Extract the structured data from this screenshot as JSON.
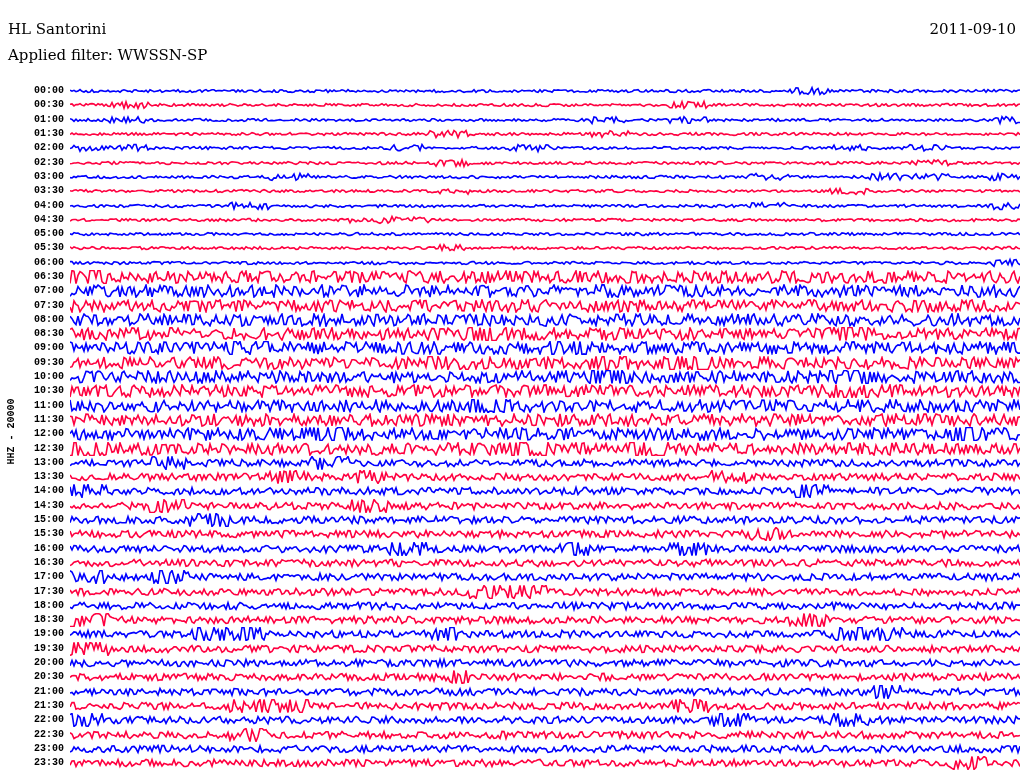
{
  "header": {
    "station": "HL Santorini",
    "date": "2011-09-10",
    "filter": "Applied filter: WWSSN-SP"
  },
  "channel_label": "HHZ - 20000",
  "rows": [
    {
      "time": "00:00",
      "color": "#0000ff"
    },
    {
      "time": "00:30",
      "color": "#ff0040"
    },
    {
      "time": "01:00",
      "color": "#0000ff"
    },
    {
      "time": "01:30",
      "color": "#ff0040"
    },
    {
      "time": "02:00",
      "color": "#0000ff"
    },
    {
      "time": "02:30",
      "color": "#ff0040"
    },
    {
      "time": "03:00",
      "color": "#0000ff"
    },
    {
      "time": "03:30",
      "color": "#ff0040"
    },
    {
      "time": "04:00",
      "color": "#0000ff"
    },
    {
      "time": "04:30",
      "color": "#ff0040"
    },
    {
      "time": "05:00",
      "color": "#0000ff"
    },
    {
      "time": "05:30",
      "color": "#ff0040"
    },
    {
      "time": "06:00",
      "color": "#0000ff"
    },
    {
      "time": "06:30",
      "color": "#ff0040"
    },
    {
      "time": "07:00",
      "color": "#0000ff"
    },
    {
      "time": "07:30",
      "color": "#ff0040"
    },
    {
      "time": "08:00",
      "color": "#0000ff"
    },
    {
      "time": "08:30",
      "color": "#ff0040"
    },
    {
      "time": "09:00",
      "color": "#0000ff"
    },
    {
      "time": "09:30",
      "color": "#ff0040"
    },
    {
      "time": "10:00",
      "color": "#0000ff"
    },
    {
      "time": "10:30",
      "color": "#ff0040"
    },
    {
      "time": "11:00",
      "color": "#0000ff"
    },
    {
      "time": "11:30",
      "color": "#ff0040"
    },
    {
      "time": "12:00",
      "color": "#0000ff"
    },
    {
      "time": "12:30",
      "color": "#ff0040"
    },
    {
      "time": "13:00",
      "color": "#0000ff"
    },
    {
      "time": "13:30",
      "color": "#ff0040"
    },
    {
      "time": "14:00",
      "color": "#0000ff"
    },
    {
      "time": "14:30",
      "color": "#ff0040"
    },
    {
      "time": "15:00",
      "color": "#0000ff"
    },
    {
      "time": "15:30",
      "color": "#ff0040"
    },
    {
      "time": "16:00",
      "color": "#0000ff"
    },
    {
      "time": "16:30",
      "color": "#ff0040"
    },
    {
      "time": "17:00",
      "color": "#0000ff"
    },
    {
      "time": "17:30",
      "color": "#ff0040"
    },
    {
      "time": "18:00",
      "color": "#0000ff"
    },
    {
      "time": "18:30",
      "color": "#ff0040"
    },
    {
      "time": "19:00",
      "color": "#0000ff"
    },
    {
      "time": "19:30",
      "color": "#ff0040"
    },
    {
      "time": "20:00",
      "color": "#0000ff"
    },
    {
      "time": "20:30",
      "color": "#ff0040"
    },
    {
      "time": "21:00",
      "color": "#0000ff"
    },
    {
      "time": "21:30",
      "color": "#ff0040"
    },
    {
      "time": "22:00",
      "color": "#0000ff"
    },
    {
      "time": "22:30",
      "color": "#ff0040"
    },
    {
      "time": "23:00",
      "color": "#0000ff"
    },
    {
      "time": "23:30",
      "color": "#ff0040"
    }
  ]
}
